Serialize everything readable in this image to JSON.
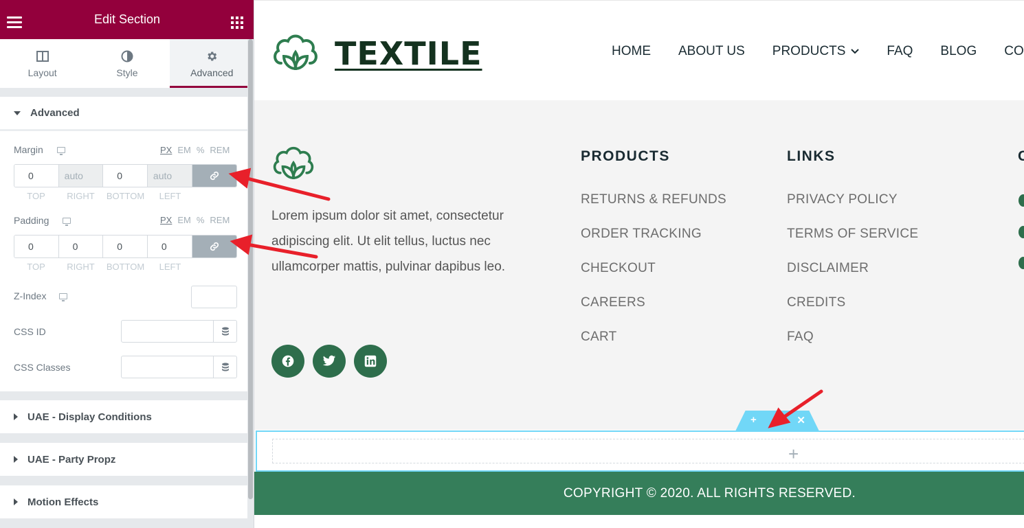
{
  "panel": {
    "title": "Edit Section",
    "tabs": [
      {
        "label": "Layout"
      },
      {
        "label": "Style"
      },
      {
        "label": "Advanced"
      }
    ],
    "advanced_section": {
      "title": "Advanced",
      "margin": {
        "label": "Margin",
        "units": [
          "PX",
          "EM",
          "%",
          "REM"
        ],
        "selected_unit": "PX",
        "values": [
          "0",
          "auto",
          "0",
          "auto"
        ],
        "sides": [
          "TOP",
          "RIGHT",
          "BOTTOM",
          "LEFT"
        ]
      },
      "padding": {
        "label": "Padding",
        "units": [
          "PX",
          "EM",
          "%",
          "REM"
        ],
        "selected_unit": "PX",
        "values": [
          "0",
          "0",
          "0",
          "0"
        ],
        "sides": [
          "TOP",
          "RIGHT",
          "BOTTOM",
          "LEFT"
        ]
      },
      "z_index": {
        "label": "Z-Index",
        "value": ""
      },
      "css_id": {
        "label": "CSS ID",
        "value": ""
      },
      "css_classes": {
        "label": "CSS Classes",
        "value": ""
      }
    },
    "collapsed_sections": [
      {
        "title": "UAE - Display Conditions"
      },
      {
        "title": "UAE - Party Propz"
      },
      {
        "title": "Motion Effects"
      }
    ]
  },
  "site": {
    "brand": "TEXTILE",
    "nav": [
      "HOME",
      "ABOUT US",
      "PRODUCTS",
      "FAQ",
      "BLOG",
      "CO"
    ],
    "footer": {
      "about_text": "Lorem ipsum dolor sit amet, consectetur adipiscing elit. Ut elit tellus, luctus nec ullamcorper mattis, pulvinar dapibus leo.",
      "social_icons": [
        "facebook-icon",
        "twitter-icon",
        "linkedin-icon"
      ],
      "products": {
        "title": "PRODUCTS",
        "items": [
          "RETURNS & REFUNDS",
          "ORDER TRACKING",
          "CHECKOUT",
          "CAREERS",
          "CART"
        ]
      },
      "links": {
        "title": "LINKS",
        "items": [
          "PRIVACY POLICY",
          "TERMS OF SERVICE",
          "DISCLAIMER",
          "CREDITS",
          "FAQ"
        ]
      },
      "cut_column_initial": "C"
    },
    "copyright": "COPYRIGHT © 2020. ALL RIGHTS RESERVED."
  },
  "colors": {
    "panel_header": "#93003c",
    "brand_green": "#357e5a",
    "editor_highlight": "#71d7f7",
    "annotation_arrow": "#e8202a"
  }
}
